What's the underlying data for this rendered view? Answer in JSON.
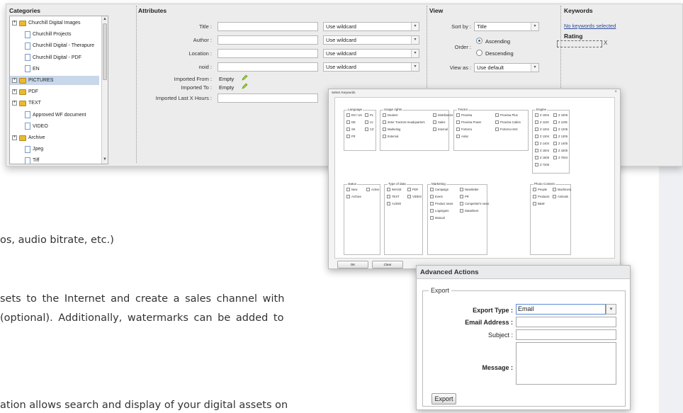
{
  "doc": {
    "line1": "os, audio bitrate, etc.)",
    "line2a": "sets to the Internet and create a sales channel with",
    "line2b": "(optional). Additionally, watermarks can be added to",
    "line3": "ation allows search and display of your digital assets on"
  },
  "panel": {
    "categories_title": "Categories",
    "attributes_title": "Attributes",
    "view_title": "View",
    "keywords_title": "Keywords",
    "categories": [
      {
        "label": "Churchill Digital Images",
        "type": "folder",
        "expandable": true
      },
      {
        "label": "Churchill Projects",
        "type": "file",
        "expandable": false
      },
      {
        "label": "Churchill Digital - Therapure",
        "type": "file",
        "expandable": false
      },
      {
        "label": "Churchill Digital - PDF",
        "type": "file",
        "expandable": false
      },
      {
        "label": "EN",
        "type": "file",
        "expandable": false
      },
      {
        "label": "PICTURES",
        "type": "folder",
        "expandable": true,
        "selected": true
      },
      {
        "label": "PDF",
        "type": "folder",
        "expandable": true
      },
      {
        "label": "TEXT",
        "type": "folder",
        "expandable": true
      },
      {
        "label": "Approved WF document",
        "type": "file",
        "expandable": false
      },
      {
        "label": "VIDEO",
        "type": "file",
        "expandable": false
      },
      {
        "label": "Archive",
        "type": "folder",
        "expandable": true
      },
      {
        "label": "Jpeg",
        "type": "file",
        "expandable": false
      },
      {
        "label": "Tiff",
        "type": "file",
        "expandable": false
      }
    ],
    "attributes": {
      "title_label": "Title :",
      "author_label": "Author :",
      "location_label": "Location :",
      "noid_label": "noid :",
      "wildcard": "Use wildcard",
      "imported_from_label": "Imported From :",
      "imported_to_label": "Imported To :",
      "imported_last_label": "Imported Last X Hours :",
      "empty": "Empty"
    },
    "view": {
      "sort_by_label": "Sort by :",
      "sort_by_value": "Title",
      "order_label": "Order :",
      "ascending": "Ascending",
      "descending": "Descending",
      "view_as_label": "View as :",
      "view_as_value": "Use default"
    },
    "keywords": {
      "none_selected": "No keywords selected",
      "rating_title": "Rating",
      "rating_clear": "X"
    }
  },
  "keywords_dialog": {
    "title": "Select Keywords",
    "close": "×",
    "ok": "OK",
    "clear": "Clear",
    "groups": {
      "language": {
        "title": "Language",
        "items": [
          "EN / UK",
          "PL",
          "DE",
          "LV",
          "SK",
          "CZ",
          "FR"
        ]
      },
      "usage": {
        "title": "Usage rights",
        "items": [
          "Dealers",
          "Distributors",
          "Zetor Tractors Headquarters",
          "Sales",
          "Marketing",
          "Internal",
          "External"
        ]
      },
      "tractor": {
        "title": "Tractor",
        "items": [
          "Proxima",
          "Proxima Plus",
          "Proxima Power",
          "Proxima Cabrio",
          "Forterra",
          "Forterra HSX",
          "Antar"
        ]
      },
      "engine": {
        "title": "Engine",
        "items": [
          "Z 1004",
          "Z 1005",
          "Z 1104",
          "Z 1105",
          "Z 1204",
          "Z 1205",
          "Z 1304",
          "Z 1305",
          "Z 1404",
          "Z 1405",
          "Z 1504",
          "Z 1505",
          "Z 1605",
          "Z 7004",
          "Z 7205"
        ]
      },
      "status": {
        "title": "status",
        "items": [
          "New",
          "Active",
          "Archive"
        ]
      },
      "type": {
        "title": "Type of data",
        "items": [
          "IMAGE",
          "PDF",
          "TEXT",
          "VIDEO",
          "AUDIO"
        ]
      },
      "marketing": {
        "title": "Marketing",
        "items": [
          "Campaign",
          "Newsletter",
          "Event",
          "PR",
          "Product news",
          "Competitor's news",
          "Logotypes",
          "Datasheet",
          "Manual"
        ]
      },
      "photo": {
        "title": "Photo Content",
        "items": [
          "People",
          "Machinery",
          "Products",
          "Animals",
          "B&W"
        ]
      }
    }
  },
  "advanced": {
    "title": "Advanced Actions",
    "legend": "Export",
    "export_type_label": "Export Type :",
    "export_type_value": "Email",
    "email_label": "Email Address :",
    "subject_label": "Subject :",
    "message_label": "Message :",
    "export_button": "Export"
  }
}
